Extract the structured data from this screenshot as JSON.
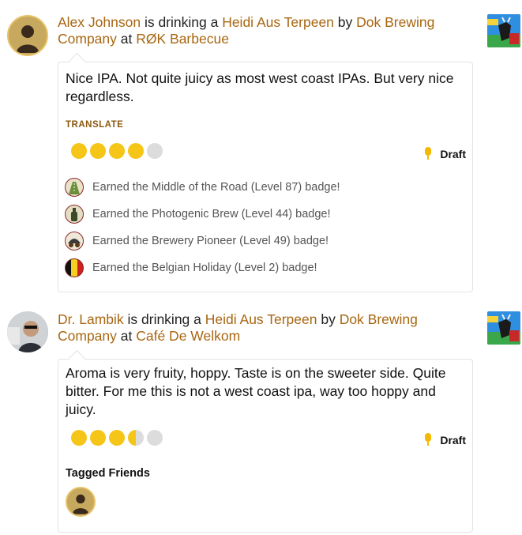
{
  "checkins": [
    {
      "user": "Alex Johnson",
      "verb1": " is drinking a ",
      "beer": "Heidi Aus Terpeen",
      "by": " by ",
      "brewery": "Dok Brewing Company",
      "at": " at ",
      "venue": "RØK Barbecue",
      "comment": "Nice IPA. Not quite juicy as most west coast IPAs. But very nice regardless.",
      "translate_label": "TRANSLATE",
      "rating": 4,
      "serving": "Draft",
      "badges": [
        {
          "text": "Earned the Middle of the Road (Level 87) badge!",
          "icon": "road-badge-icon"
        },
        {
          "text": "Earned the Photogenic Brew (Level 44) badge!",
          "icon": "camera-bottle-badge-icon"
        },
        {
          "text": "Earned the Brewery Pioneer (Level 49) badge!",
          "icon": "wagon-badge-icon"
        },
        {
          "text": "Earned the Belgian Holiday (Level 2) badge!",
          "icon": "belgium-flag-badge-icon"
        }
      ]
    },
    {
      "user": "Dr. Lambik",
      "verb1": " is drinking a ",
      "beer": "Heidi Aus Terpeen",
      "by": " by ",
      "brewery": "Dok Brewing Company",
      "at": " at ",
      "venue": "Café De Welkom",
      "comment": "Aroma is very fruity, hoppy. Taste is on the sweeter side. Quite bitter. For me this is not a west coast ipa, way too hoppy and juicy.",
      "rating": 3.5,
      "serving": "Draft",
      "tagged_label": "Tagged Friends"
    }
  ],
  "colors": {
    "link": "#a86610",
    "cap": "#f5c518",
    "cap_empty": "#dcdcdc"
  }
}
